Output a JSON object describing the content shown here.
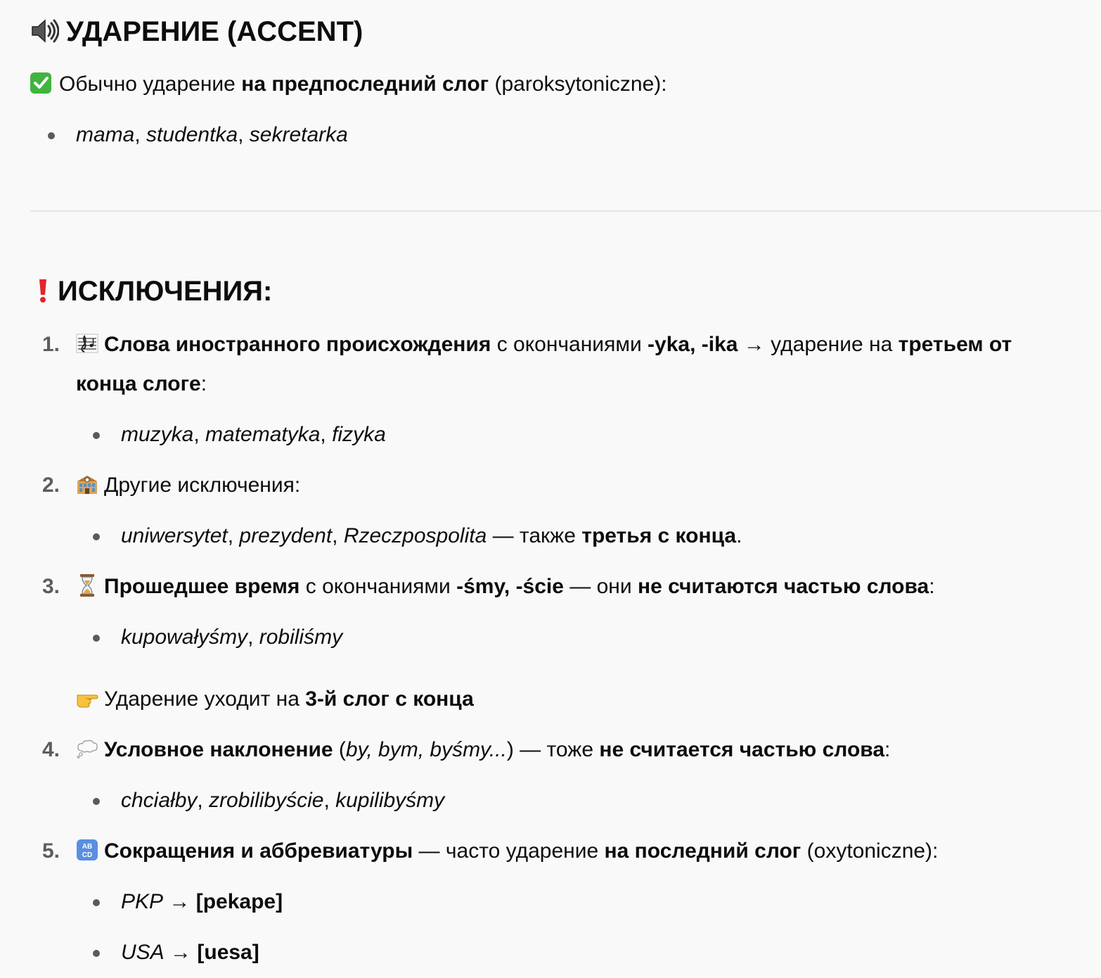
{
  "section_accent": {
    "title": "УДАРЕНИЕ (ACCENT)",
    "icon": "speaker-icon",
    "rule": {
      "icon": "check-mark-icon",
      "text_before": "Обычно ударение ",
      "bold": "на предпоследний слог",
      "text_after": " (paroksytoniczne):"
    },
    "examples": [
      "mama",
      "studentka",
      "sekretarka"
    ]
  },
  "section_exceptions": {
    "title": "ИСКЛЮЧЕНИЯ:",
    "icon": "exclamation-icon",
    "items": [
      {
        "number": "1.",
        "icon": "musical-score-icon",
        "bold1": "Слова иностранного происхождения",
        "text1": " с окончаниями ",
        "bold2": "-yka, -ika",
        "text2": " → ударение на ",
        "bold3": "третьем от",
        "bold3_line2": "конца слоге",
        "text3": ":",
        "examples": [
          "muzyka",
          "matematyka",
          "fizyka"
        ]
      },
      {
        "number": "2.",
        "icon": "school-building-icon",
        "text1": "Другие исключения:",
        "examples": [
          "uniwersytet",
          "prezydent",
          "Rzeczpospolita"
        ],
        "example_tail_text": " — также ",
        "example_tail_bold": "третья с конца",
        "example_tail_end": "."
      },
      {
        "number": "3.",
        "icon": "hourglass-icon",
        "bold1": "Прошедшее время",
        "text1": " с окончаниями ",
        "bold2": "-śmy, -ście",
        "text2": " — они ",
        "bold3": "не считаются частью слова",
        "text3": ":",
        "examples": [
          "kupowałyśmy",
          "robiliśmy"
        ],
        "note_icon": "pointing-hand-icon",
        "note_text": "Ударение уходит на ",
        "note_bold": "3-й слог с конца"
      },
      {
        "number": "4.",
        "icon": "thought-balloon-icon",
        "bold1": "Условное наклонение",
        "text1": " (",
        "italic1": "by, bym, byśmy...",
        "text2": ") — тоже ",
        "bold2": "не считается частью слова",
        "text3": ":",
        "examples": [
          "chciałby",
          "zrobilibyście",
          "kupilibyśmy"
        ]
      },
      {
        "number": "5.",
        "icon": "abcd-icon",
        "icon_text_top": "AB",
        "icon_text_bottom": "CD",
        "bold1": "Сокращения и аббревиатуры",
        "text1": " — часто ударение ",
        "bold2": "на последний слог",
        "text2": " (oxytoniczne):",
        "abbreviations": [
          {
            "abbr": "PKP",
            "arrow": "→",
            "reading": "[pekape]"
          },
          {
            "abbr": "USA",
            "arrow": "→",
            "reading": "[uesa]"
          }
        ]
      }
    ]
  },
  "separator": ", "
}
